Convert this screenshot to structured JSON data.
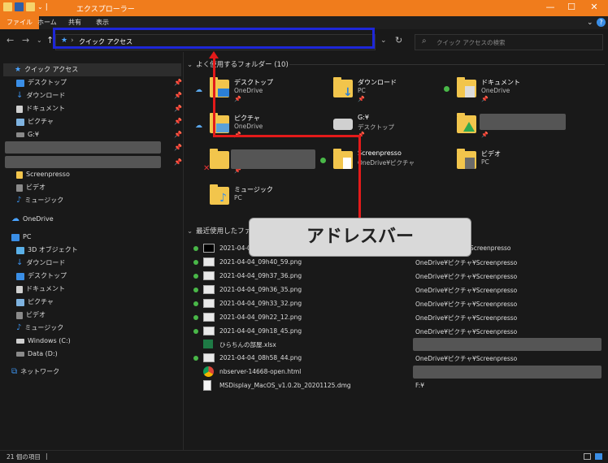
{
  "window": {
    "title": "エクスプローラー",
    "controls": [
      "—",
      "☐",
      "✕"
    ]
  },
  "ribbon": {
    "tabs": [
      "ファイル",
      "ホーム",
      "共有",
      "表示"
    ]
  },
  "nav": {
    "back": "←",
    "forward": "→",
    "recent": "⌄",
    "up": "↑",
    "address": "クイック アクセス",
    "address_chevron": "›",
    "dropdown": "⌄",
    "refresh": "↻",
    "search_placeholder": "クイック アクセスの検索"
  },
  "sidebar": {
    "items": [
      {
        "label": "クイック アクセス",
        "icon": "star-icon",
        "color": "#4aa3ff"
      },
      {
        "label": "デスクトップ",
        "icon": "desktop-icon",
        "color": "#3a8ee6",
        "pinned": true
      },
      {
        "label": "ダウンロード",
        "icon": "download-icon",
        "color": "#3a8ee6",
        "pinned": true
      },
      {
        "label": "ドキュメント",
        "icon": "document-icon",
        "color": "#cfcfcf",
        "pinned": true
      },
      {
        "label": "ピクチャ",
        "icon": "picture-icon",
        "color": "#7fb3e0",
        "pinned": true
      },
      {
        "label": "G:¥",
        "icon": "drive-icon",
        "color": "#8a8a8a",
        "pinned": true
      },
      {
        "label": "Screenpresso",
        "icon": "folder-icon",
        "color": "#f2c54c"
      },
      {
        "label": "ビデオ",
        "icon": "video-icon",
        "color": "#8a8a8a"
      },
      {
        "label": "ミュージック",
        "icon": "music-icon",
        "color": "#3a8ee6"
      },
      {
        "label": "OneDrive",
        "icon": "cloud-icon",
        "color": "#4aa3ff"
      },
      {
        "label": "PC",
        "icon": "pc-icon",
        "color": "#3a8ee6"
      },
      {
        "label": "3D オブジェクト",
        "icon": "cube-icon",
        "color": "#5ab0e8"
      },
      {
        "label": "ダウンロード",
        "icon": "download-icon",
        "color": "#3a8ee6"
      },
      {
        "label": "デスクトップ",
        "icon": "desktop-icon",
        "color": "#3a8ee6"
      },
      {
        "label": "ドキュメント",
        "icon": "document-icon",
        "color": "#cfcfcf"
      },
      {
        "label": "ピクチャ",
        "icon": "picture-icon",
        "color": "#7fb3e0"
      },
      {
        "label": "ビデオ",
        "icon": "video-icon",
        "color": "#8a8a8a"
      },
      {
        "label": "ミュージック",
        "icon": "music-icon",
        "color": "#3a8ee6"
      },
      {
        "label": "Windows (C:)",
        "icon": "windows-drive-icon",
        "color": "#cfcfcf"
      },
      {
        "label": "Data (D:)",
        "icon": "drive-icon",
        "color": "#8a8a8a"
      },
      {
        "label": "ネットワーク",
        "icon": "network-icon",
        "color": "#3a8ee6"
      }
    ]
  },
  "frequent": {
    "heading": "よく使用するフォルダー (10)",
    "chevron": "⌄",
    "folders": [
      {
        "name": "デスクトップ",
        "sub": "OneDrive",
        "status": "cloud",
        "overlay": "#2b7fd6"
      },
      {
        "name": "ダウンロード",
        "sub": "PC",
        "status": "",
        "overlay": "#2b7fd6"
      },
      {
        "name": "ドキュメント",
        "sub": "OneDrive",
        "status": "ok",
        "overlay": "#dcdcdc"
      },
      {
        "name": "ピクチャ",
        "sub": "OneDrive",
        "status": "cloud",
        "overlay": "#5aa0d8"
      },
      {
        "name": "G:¥",
        "sub": "デスクトップ",
        "status": "",
        "overlay": ""
      },
      {
        "name": "",
        "sub": "",
        "status": "",
        "overlay": "#2fa84f"
      },
      {
        "name": "",
        "sub": "",
        "status": "",
        "overlay": ""
      },
      {
        "name": "Screenpresso",
        "sub": "OneDrive¥ピクチャ",
        "status": "ok",
        "overlay": "#ffffff"
      },
      {
        "name": "ビデオ",
        "sub": "PC",
        "status": "",
        "overlay": "#6a6a6a"
      },
      {
        "name": "ミュージック",
        "sub": "PC",
        "status": "",
        "overlay": "#3a8ee6"
      }
    ]
  },
  "recent": {
    "heading": "最近使用したファ",
    "chevron": "⌄",
    "files": [
      {
        "name": "2021-04-0",
        "location": "Screenpresso",
        "ok": true,
        "thumb": "#000000"
      },
      {
        "name": "2021-04-04_09h40_59.png",
        "location": "OneDrive¥ピクチャ¥Screenpresso",
        "ok": true,
        "thumb": "#e8e8e8"
      },
      {
        "name": "2021-04-04_09h37_36.png",
        "location": "OneDrive¥ピクチャ¥Screenpresso",
        "ok": true,
        "thumb": "#e8e8e8"
      },
      {
        "name": "2021-04-04_09h36_35.png",
        "location": "OneDrive¥ピクチャ¥Screenpresso",
        "ok": true,
        "thumb": "#e8e8e8"
      },
      {
        "name": "2021-04-04_09h33_32.png",
        "location": "OneDrive¥ピクチャ¥Screenpresso",
        "ok": true,
        "thumb": "#e8e8e8"
      },
      {
        "name": "2021-04-04_09h22_12.png",
        "location": "OneDrive¥ピクチャ¥Screenpresso",
        "ok": true,
        "thumb": "#e8e8e8"
      },
      {
        "name": "2021-04-04_09h18_45.png",
        "location": "OneDrive¥ピクチャ¥Screenpresso",
        "ok": true,
        "thumb": "#e8e8e8"
      },
      {
        "name": "ひらちんの部屋.xlsx",
        "location": "",
        "ok": false,
        "thumb": "#1e7a45"
      },
      {
        "name": "2021-04-04_08h58_44.png",
        "location": "OneDrive¥ピクチャ¥Screenpresso",
        "ok": true,
        "thumb": "#e8e8e8"
      },
      {
        "name": "nbserver-14668-open.html",
        "location": "",
        "ok": false,
        "thumb": "#db4437"
      },
      {
        "name": "MSDisplay_MacOS_v1.0.2b_20201125.dmg",
        "location": "F:¥",
        "ok": false,
        "thumb": "#f5f5f5"
      }
    ]
  },
  "annotation": {
    "label": "アドレスバー",
    "box_color": "#1e27d8",
    "arrow_color": "#e31a1a"
  },
  "status": {
    "item_count": "21 個の項目",
    "separator": "|"
  }
}
